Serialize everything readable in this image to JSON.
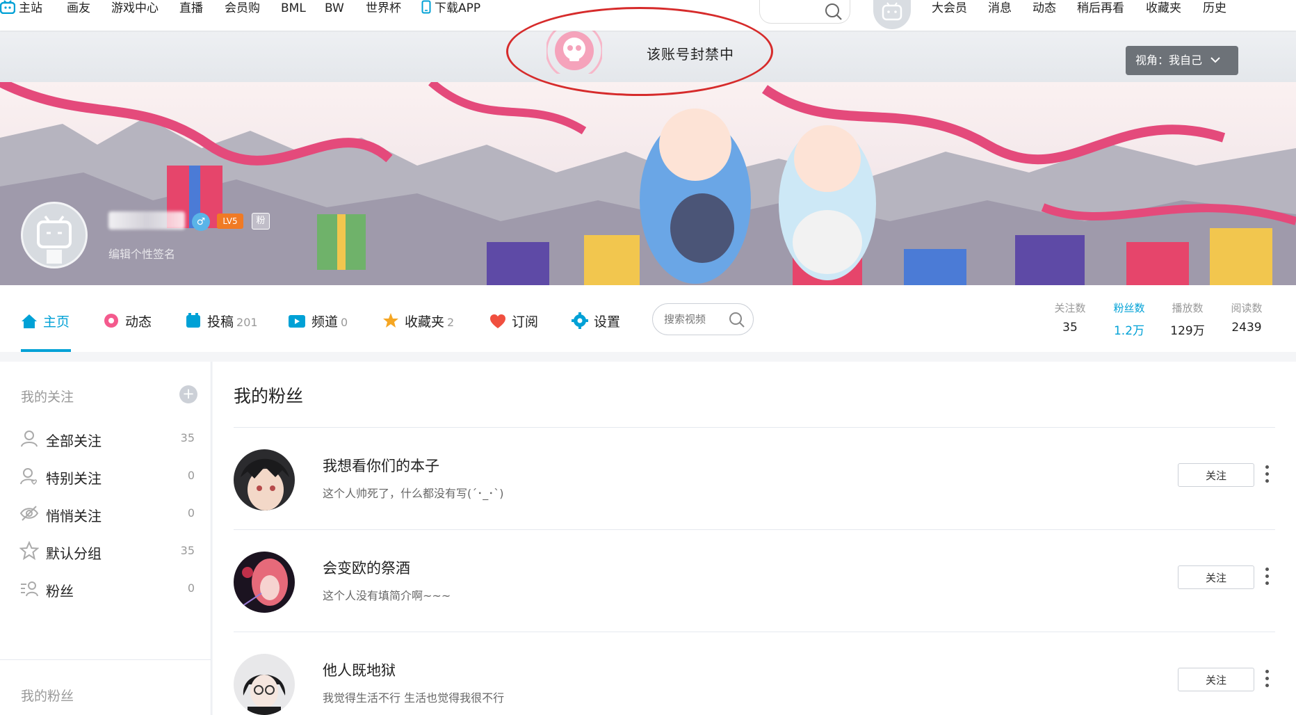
{
  "topnav": {
    "items": [
      "主站",
      "画友",
      "游戏中心",
      "直播",
      "会员购",
      "BML",
      "BW",
      "世界杯",
      "下载APP"
    ],
    "right_items": [
      "大会员",
      "消息",
      "动态",
      "稍后再看",
      "收藏夹",
      "历史"
    ],
    "upload_label": "投稿"
  },
  "ban": {
    "text": "该账号封禁中",
    "view_label": "视角：我自己"
  },
  "profile": {
    "level": "LV5",
    "fan_badge": "粉",
    "signature": "编辑个性签名"
  },
  "tabs": [
    {
      "label": "主页",
      "count": "",
      "icon": "home-icon"
    },
    {
      "label": "动态",
      "count": "",
      "icon": "dynamic-icon"
    },
    {
      "label": "投稿",
      "count": "201",
      "icon": "upload-icon"
    },
    {
      "label": "频道",
      "count": "0",
      "icon": "channel-icon"
    },
    {
      "label": "收藏夹",
      "count": "2",
      "icon": "favorite-icon"
    },
    {
      "label": "订阅",
      "count": "",
      "icon": "subscribe-icon"
    },
    {
      "label": "设置",
      "count": "",
      "icon": "settings-icon"
    }
  ],
  "video_search": {
    "placeholder": "搜索视频"
  },
  "stats": [
    {
      "label": "关注数",
      "value": "35"
    },
    {
      "label": "粉丝数",
      "value": "1.2万"
    },
    {
      "label": "播放数",
      "value": "129万"
    },
    {
      "label": "阅读数",
      "value": "2439"
    }
  ],
  "sidebar": {
    "heading": "我的关注",
    "items": [
      {
        "label": "全部关注",
        "count": "35"
      },
      {
        "label": "特别关注",
        "count": "0"
      },
      {
        "label": "悄悄关注",
        "count": "0"
      },
      {
        "label": "默认分组",
        "count": "35"
      },
      {
        "label": "粉丝",
        "count": "0"
      }
    ],
    "heading2": "我的粉丝"
  },
  "main": {
    "title": "我的粉丝",
    "follow_label": "关注",
    "fans": [
      {
        "name": "我想看你们的本子",
        "bio": "这个人帅死了，什么都没有写(´･_･`)"
      },
      {
        "name": "会变欧的祭酒",
        "bio": "这个人没有填简介啊~~~"
      },
      {
        "name": "他人既地狱",
        "bio": "我觉得生活不行 生活也觉得我很不行"
      }
    ]
  },
  "colors": {
    "accent": "#00a1d6",
    "pink": "#f45a8d",
    "ban_red": "#d62b2b"
  }
}
